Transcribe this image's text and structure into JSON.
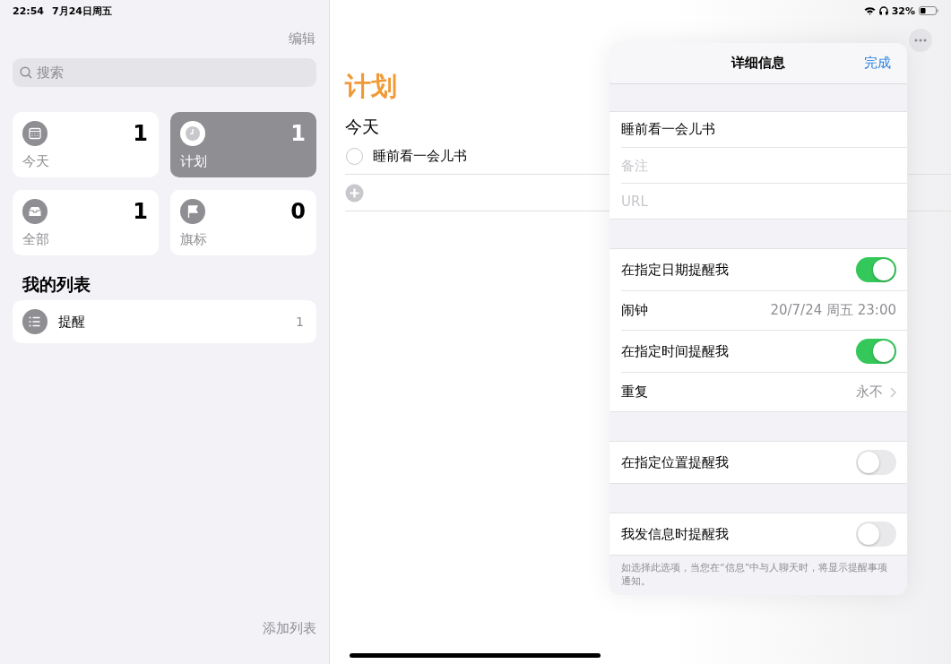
{
  "status_bar": {
    "time": "22:54",
    "date": "7月24日周五",
    "battery_percent": "32%"
  },
  "sidebar": {
    "edit": "编辑",
    "search": {
      "placeholder": "搜索"
    },
    "smart_lists": [
      {
        "kind": "today",
        "label": "今天",
        "count": "1",
        "selected": false
      },
      {
        "kind": "scheduled",
        "label": "计划",
        "count": "1",
        "selected": true
      },
      {
        "kind": "all",
        "label": "全部",
        "count": "1",
        "selected": false
      },
      {
        "kind": "flagged",
        "label": "旗标",
        "count": "0",
        "selected": false
      }
    ],
    "my_lists_title": "我的列表",
    "lists": [
      {
        "name": "提醒",
        "count": "1"
      }
    ],
    "add_list": "添加列表"
  },
  "main": {
    "title": "计划",
    "sections": [
      {
        "title": "今天",
        "tasks": [
          {
            "title": "睡前看一会儿书",
            "completed": false
          }
        ]
      }
    ]
  },
  "details": {
    "title": "详细信息",
    "done": "完成",
    "fields": [
      {
        "value": "睡前看一会儿书"
      },
      {
        "placeholder": "备注"
      },
      {
        "placeholder": "URL"
      }
    ],
    "groups": [
      {
        "rows": [
          {
            "kind": "toggle",
            "label": "在指定日期提醒我",
            "on": true
          },
          {
            "kind": "value",
            "label": "闹钟",
            "value": "20/7/24 周五 23:00"
          },
          {
            "kind": "toggle",
            "label": "在指定时间提醒我",
            "on": true
          },
          {
            "kind": "disclosure",
            "label": "重复",
            "value": "永不"
          }
        ]
      },
      {
        "rows": [
          {
            "kind": "toggle",
            "label": "在指定位置提醒我",
            "on": false
          }
        ]
      },
      {
        "rows": [
          {
            "kind": "toggle",
            "label": "我发信息时提醒我",
            "on": false
          }
        ],
        "footnote": "如选择此选项，当您在“信息”中与人聊天时，将显示提醒事项通知。"
      }
    ]
  }
}
